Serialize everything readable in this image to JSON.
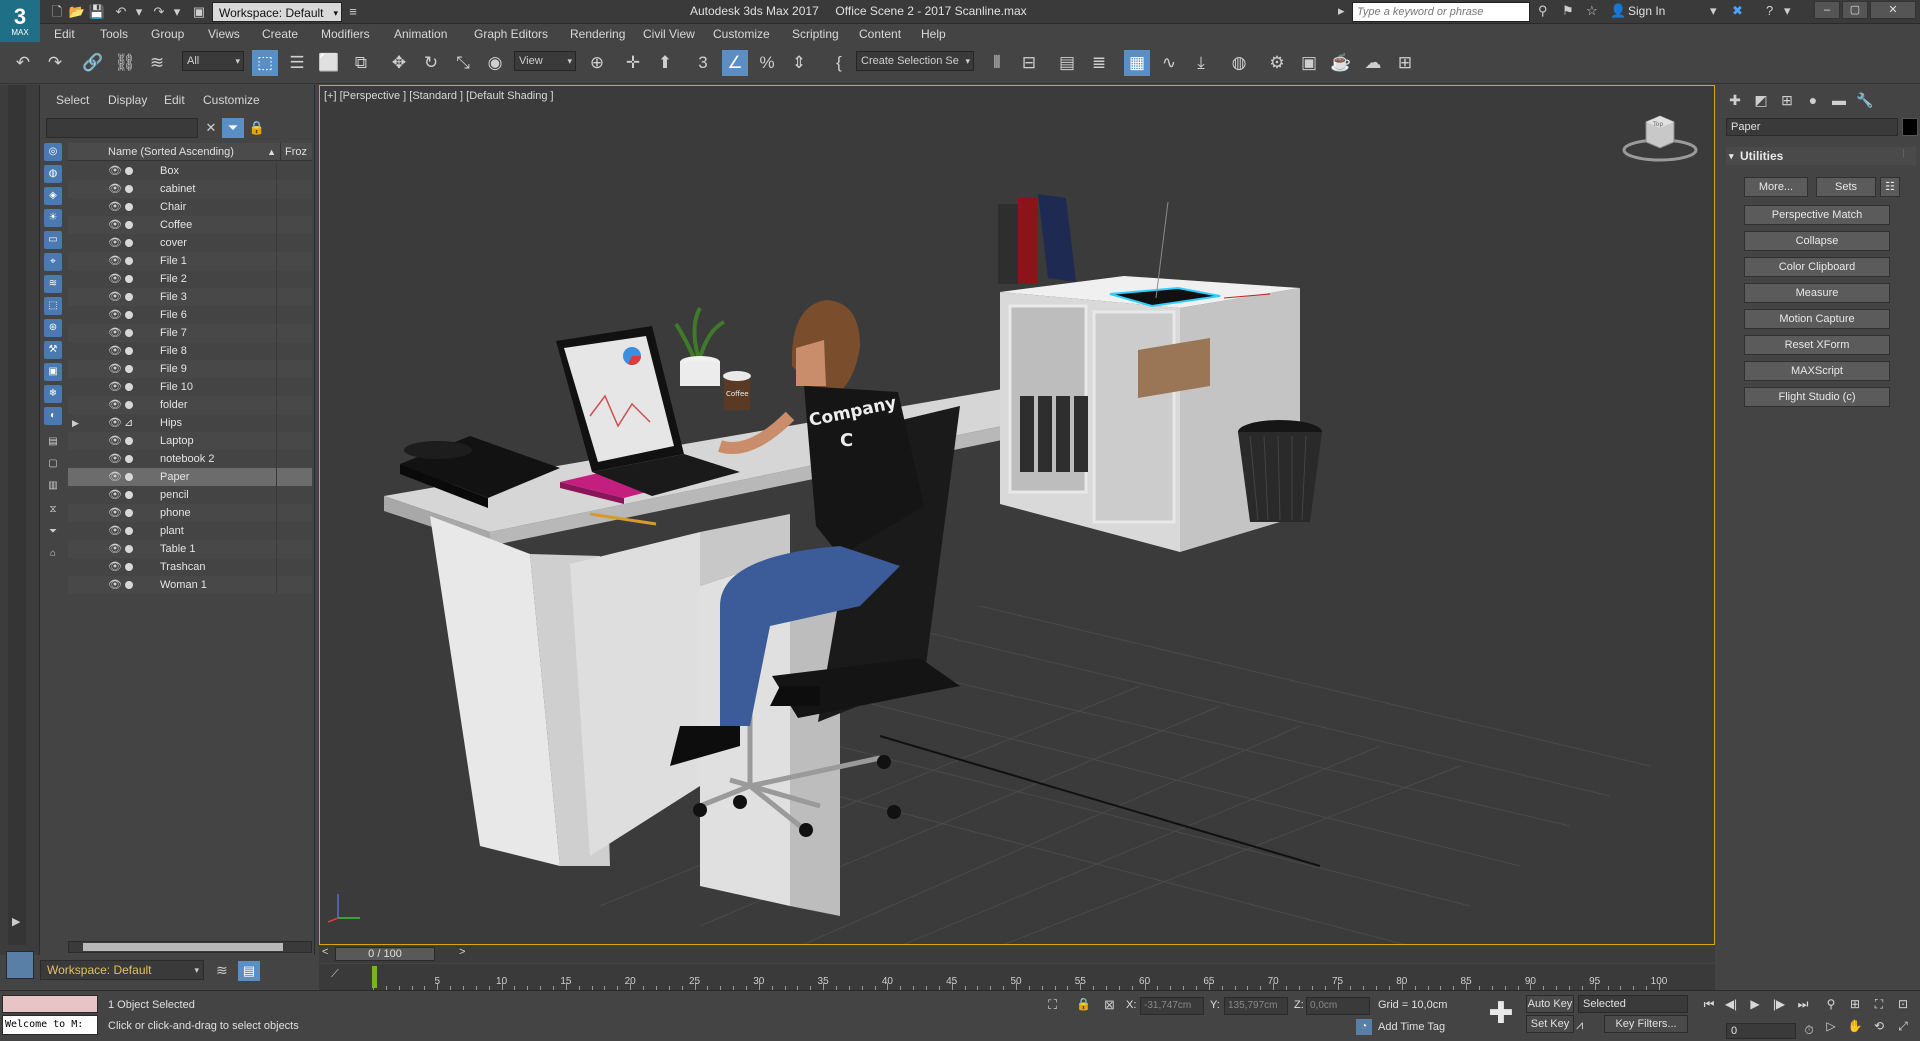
{
  "app": {
    "title": "Autodesk 3ds Max 2017",
    "file": "Office Scene 2 - 2017 Scanline.max",
    "logo_number": "3",
    "logo_text": "MAX",
    "workspace": "Workspace: Default",
    "search_placeholder": "Type a keyword or phrase",
    "sign_in": "Sign In"
  },
  "menu": [
    "Edit",
    "Tools",
    "Group",
    "Views",
    "Create",
    "Modifiers",
    "Animation",
    "Graph Editors",
    "Rendering",
    "Civil View",
    "Customize",
    "Scripting",
    "Content",
    "Help"
  ],
  "toolbar": {
    "filter_value": "All",
    "refcoord_value": "View",
    "selection_set_value": "Create Selection Se"
  },
  "explorer": {
    "menu": [
      "Select",
      "Display",
      "Edit",
      "Customize"
    ],
    "col_name": "Name (Sorted Ascending)",
    "col_frozen": "Froz",
    "sort_arrow": "▲",
    "objects": [
      {
        "name": "Box"
      },
      {
        "name": "cabinet"
      },
      {
        "name": "Chair"
      },
      {
        "name": "Coffee"
      },
      {
        "name": "cover"
      },
      {
        "name": "File 1"
      },
      {
        "name": "File 2"
      },
      {
        "name": "File 3"
      },
      {
        "name": "File 6"
      },
      {
        "name": "File 7"
      },
      {
        "name": "File 8"
      },
      {
        "name": "File 9"
      },
      {
        "name": "File 10"
      },
      {
        "name": "folder"
      },
      {
        "name": "Hips"
      },
      {
        "name": "Laptop"
      },
      {
        "name": "notebook 2"
      },
      {
        "name": "Paper"
      },
      {
        "name": "pencil"
      },
      {
        "name": "phone"
      },
      {
        "name": "plant"
      },
      {
        "name": "Table 1"
      },
      {
        "name": "Trashcan"
      },
      {
        "name": "Woman 1"
      }
    ],
    "selected": "Paper",
    "expandable": "Hips",
    "workspace_bottom": "Workspace: Default"
  },
  "viewport": {
    "label": "[+] [Perspective ] [Standard ] [Default Shading ]",
    "shirt_text_1": "Company",
    "shirt_text_2": "C",
    "cup_text": "Coffee",
    "viewcube_label": "Top",
    "colors": {
      "selection_border": "#d8a800",
      "background": "#3b3b3b"
    }
  },
  "command_panel": {
    "object_name": "Paper",
    "rollout_title": "Utilities",
    "more_button": "More...",
    "sets_button": "Sets",
    "utilities": [
      "Perspective Match",
      "Collapse",
      "Color Clipboard",
      "Measure",
      "Motion Capture",
      "Reset XForm",
      "MAXScript",
      "Flight Studio (c)"
    ]
  },
  "timeline": {
    "slider_text": "0 / 100",
    "prev": "<",
    "next": ">",
    "ticks": [
      0,
      5,
      10,
      15,
      20,
      25,
      30,
      35,
      40,
      45,
      50,
      55,
      60,
      65,
      70,
      75,
      80,
      85,
      90,
      95,
      100
    ]
  },
  "status": {
    "maxscript_text": "Welcome to M:",
    "selection": "1 Object Selected",
    "prompt": "Click or click-and-drag to select objects",
    "x_label": "X:",
    "x_value": "-31,747cm",
    "y_label": "Y:",
    "y_value": "135,797cm",
    "z_label": "Z:",
    "z_value": "0,0cm",
    "grid": "Grid = 10,0cm",
    "add_time_tag": "Add Time Tag",
    "auto_key": "Auto Key",
    "set_key": "Set Key",
    "key_mode": "Selected",
    "key_filters": "Key Filters...",
    "frame": "0"
  }
}
